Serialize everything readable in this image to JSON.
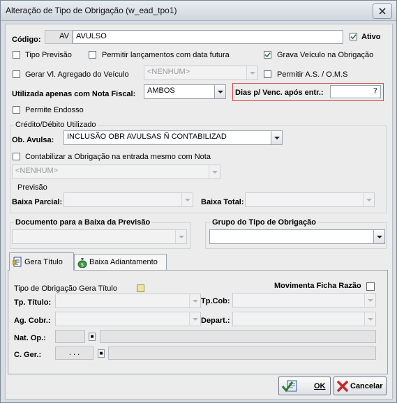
{
  "window": {
    "title": "Alteração de Tipo de Obrigação (w_ead_tpo1)"
  },
  "form": {
    "codigo_label": "Código:",
    "codigo_prefix": "AV",
    "codigo_value": "AVULSO",
    "ativo_label": "Ativo",
    "ativo_checked": true,
    "tipo_previsao_label": "Tipo Previsão",
    "permitir_lanc_label": "Permitir lançamentos com data futura",
    "grava_veiculo_label": "Grava Veículo na Obrigação",
    "grava_veiculo_checked": true,
    "gerar_vl_label": "Gerar Vl. Agregado do Veículo",
    "gerar_vl_combo": "<NENHUM>",
    "permitir_as_label": "Permitir A.S. / O.M.S",
    "utilizada_label": "Utilizada apenas com Nota Fiscal:",
    "utilizada_value": "AMBOS",
    "dias_label": "Dias p/ Venc. após entr.:",
    "dias_value": "7",
    "permite_endosso_label": "Permite Endosso"
  },
  "credito": {
    "group_label": "Crédito/Débito Utilizado",
    "ob_avulsa_label": "Ob. Avulsa:",
    "ob_avulsa_value": "INCLUSÃO OBR AVULSAS Ñ CONTABILIZAD",
    "contabilizar_label": "Contabilizar a Obrigação na entrada mesmo com Nota",
    "contabilizar_combo": "<NENHUM>",
    "previsao_label": "Previsão",
    "baixa_parcial_label": "Baixa Parcial:",
    "baixa_total_label": "Baixa Total:"
  },
  "documento": {
    "label": "Documento para a Baixa da Previsão",
    "grupo_label": "Grupo do Tipo de Obrigação"
  },
  "tabs": [
    {
      "label": "Gera Título",
      "active": true
    },
    {
      "label": "Baixa Adiantamento",
      "active": false
    }
  ],
  "gera_titulo": {
    "tipo_obr_label": "Tipo de Obrigação Gera Título",
    "movimenta_label": "Movimenta Ficha Razão",
    "tp_titulo_label": "Tp. Título:",
    "tp_cob_label": "Tp.Cob:",
    "ag_cobr_label": "Ag. Cobr.:",
    "depart_label": "Depart.:",
    "nat_op_label": "Nat. Op.:",
    "c_ger_label": "C. Ger.:",
    "c_ger_value": ". . ."
  },
  "buttons": {
    "ok": "OK",
    "cancelar": "Cancelar"
  },
  "colors": {
    "highlight_border": "#d44a4a",
    "check_green": "#2e7d32"
  }
}
